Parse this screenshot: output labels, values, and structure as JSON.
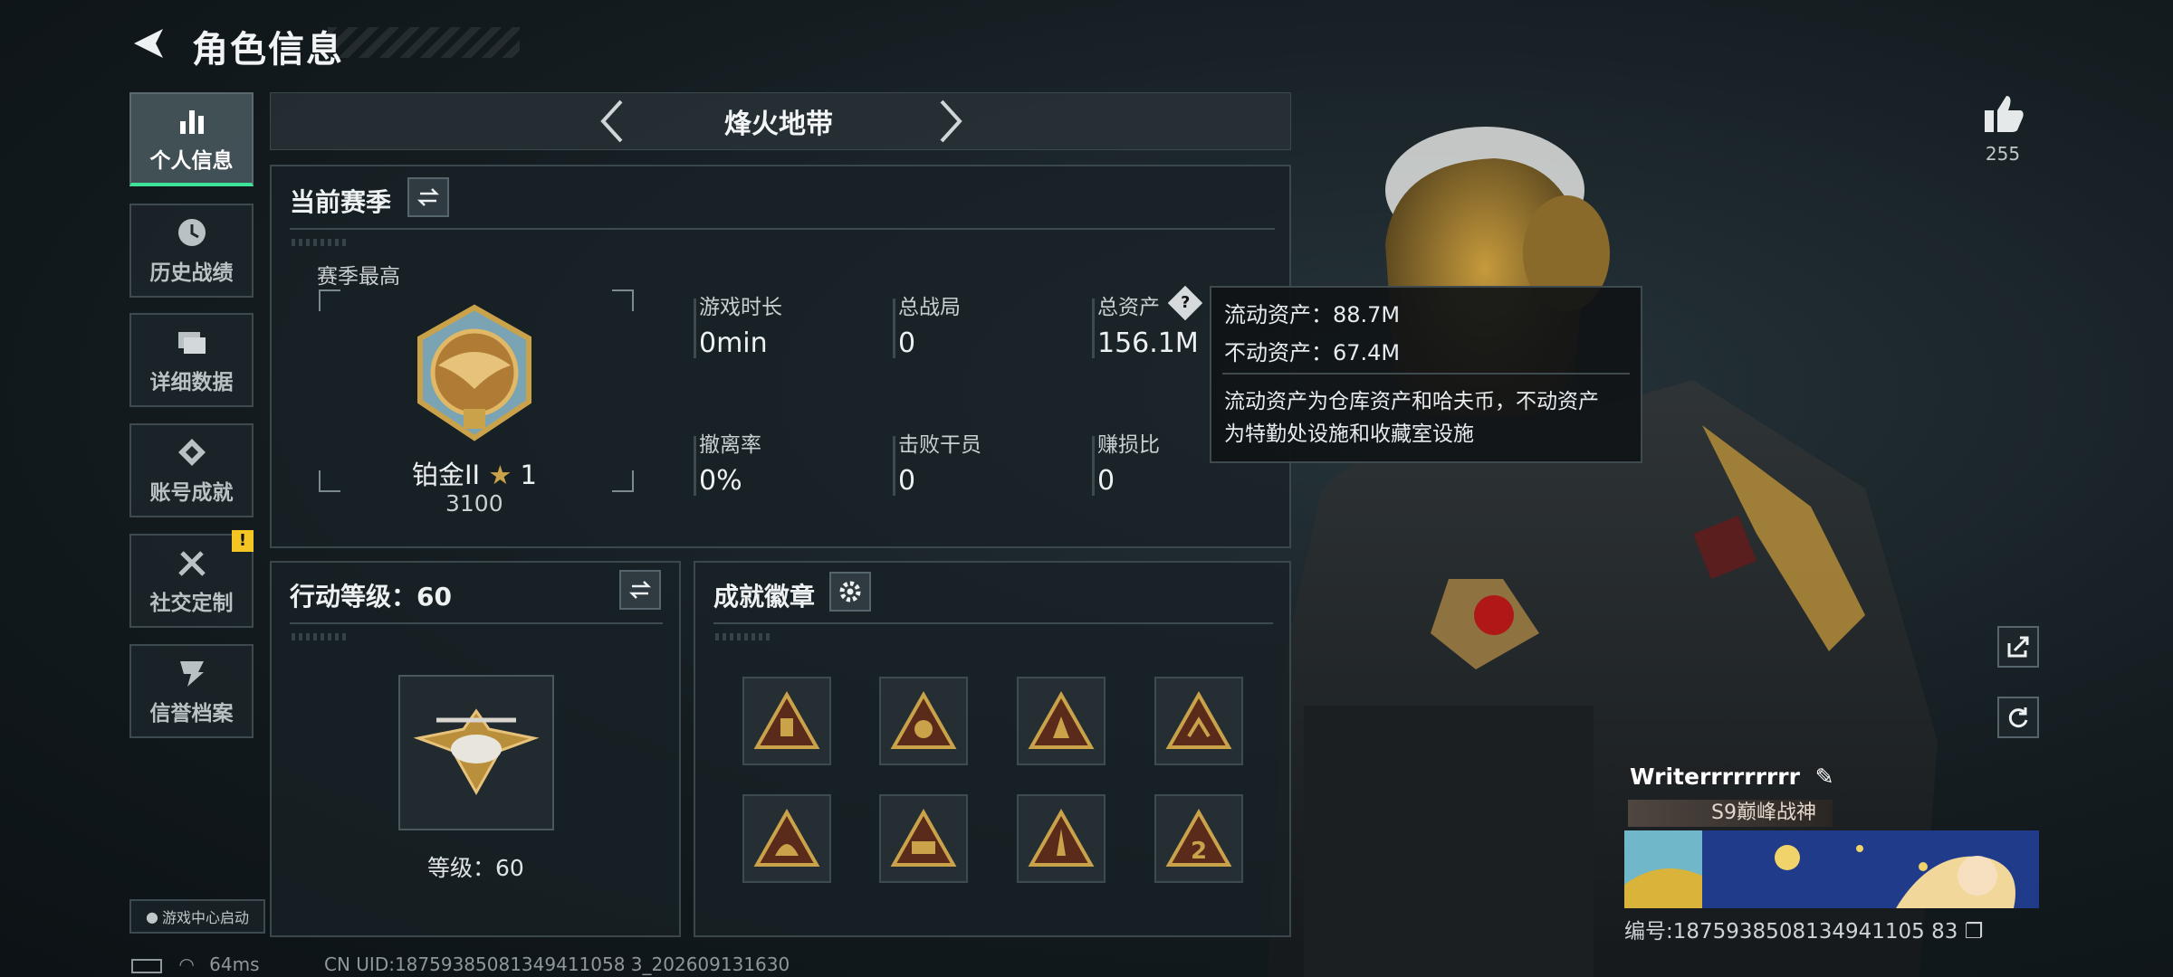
{
  "header": {
    "title": "角色信息"
  },
  "nav": [
    {
      "label": "个人信息",
      "icon": "bar-chart-icon",
      "active": true
    },
    {
      "label": "历史战绩",
      "icon": "clock-icon"
    },
    {
      "label": "详细数据",
      "icon": "folder-icon"
    },
    {
      "label": "账号成就",
      "icon": "achievement-icon"
    },
    {
      "label": "社交定制",
      "icon": "tools-icon",
      "badge": "!"
    },
    {
      "label": "信誉档案",
      "icon": "reputation-icon"
    }
  ],
  "launch_button": "游戏中心启动",
  "mode": {
    "label": "烽火地带"
  },
  "season": {
    "title": "当前赛季",
    "best_label": "赛季最高",
    "rank_name": "铂金II",
    "rank_stars": "1",
    "rank_points": "3100",
    "stats": [
      {
        "label": "游戏时长",
        "value": "0min"
      },
      {
        "label": "总战局",
        "value": "0"
      },
      {
        "label": "总资产",
        "value": "156.1M"
      },
      {
        "label": "撤离率",
        "value": "0%"
      },
      {
        "label": "击败干员",
        "value": "0"
      },
      {
        "label": "赚损比",
        "value": "0"
      }
    ]
  },
  "tooltip": {
    "liquid": "流动资产：88.7M",
    "fixed": "不动资产：67.4M",
    "desc_line1": "流动资产为仓库资产和哈夫币，不动资产",
    "desc_line2": "为特勤处设施和收藏室设施"
  },
  "action_level": {
    "title": "行动等级：60",
    "level_text": "等级：60"
  },
  "achievements": {
    "title": "成就徽章",
    "badges": [
      "badge-1",
      "badge-2",
      "badge-3",
      "badge-4",
      "badge-5",
      "badge-6",
      "badge-7",
      "badge-8"
    ]
  },
  "likes": {
    "count": "255"
  },
  "player": {
    "name": "Writerrrrrrrrr",
    "title": "S9巅峰战神",
    "id": "编号:1875938508134941105 83"
  },
  "status": {
    "ping": "64ms",
    "uid": "CN UID:18759385081349411058 3_202609131630"
  },
  "colors": {
    "accent": "#3ee39b",
    "gold": "#c9a24a",
    "badge_warning": "#f3c623"
  }
}
